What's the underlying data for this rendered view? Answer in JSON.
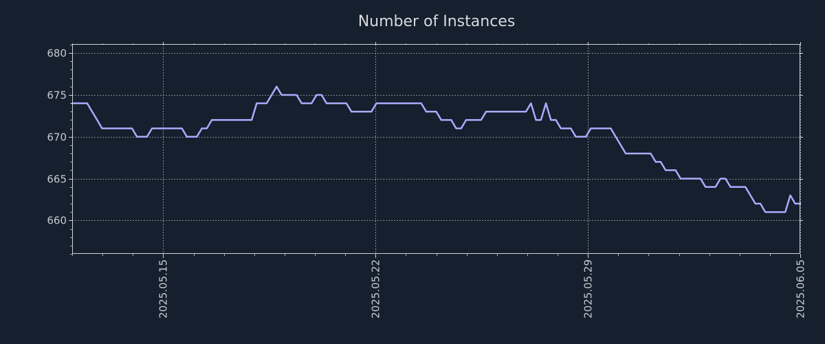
{
  "chart_data": {
    "type": "line",
    "title": "Number of Instances",
    "xlabel": "",
    "ylabel": "",
    "x_start": "2025.05.12",
    "x_end": "2025.06.05",
    "xlim": [
      "2025.05.12",
      "2025.06.05"
    ],
    "ylim": [
      656,
      681
    ],
    "yticks": [
      660,
      665,
      670,
      675,
      680
    ],
    "xticks": [
      "2025.05.15",
      "2025.05.22",
      "2025.05.29",
      "2025.06.05"
    ],
    "grid": true,
    "legend": "none",
    "line_color": "#a9acff",
    "grid_color": "#aab0b8",
    "axis_color": "#d0d4da",
    "background": "#151f2d",
    "series": [
      {
        "values": [
          674,
          674,
          674,
          674,
          673,
          672,
          671,
          671,
          671,
          671,
          671,
          671,
          671,
          670,
          670,
          670,
          671,
          671,
          671,
          671,
          671,
          671,
          671,
          670,
          670,
          670,
          671,
          671,
          672,
          672,
          672,
          672,
          672,
          672,
          672,
          672,
          672,
          674,
          674,
          674,
          675,
          676,
          675,
          675,
          675,
          675,
          674,
          674,
          674,
          675,
          675,
          674,
          674,
          674,
          674,
          674,
          673,
          673,
          673,
          673,
          673,
          674,
          674,
          674,
          674,
          674,
          674,
          674,
          674,
          674,
          674,
          673,
          673,
          673,
          672,
          672,
          672,
          671,
          671,
          672,
          672,
          672,
          672,
          673,
          673,
          673,
          673,
          673,
          673,
          673,
          673,
          673,
          674,
          672,
          672,
          674,
          672,
          672,
          671,
          671,
          671,
          670,
          670,
          670,
          671,
          671,
          671,
          671,
          671,
          670,
          669,
          668,
          668,
          668,
          668,
          668,
          668,
          667,
          667,
          666,
          666,
          666,
          665,
          665,
          665,
          665,
          665,
          664,
          664,
          664,
          665,
          665,
          664,
          664,
          664,
          664,
          663,
          662,
          662,
          661,
          661,
          661,
          661,
          661,
          663,
          662,
          662
        ]
      }
    ]
  }
}
